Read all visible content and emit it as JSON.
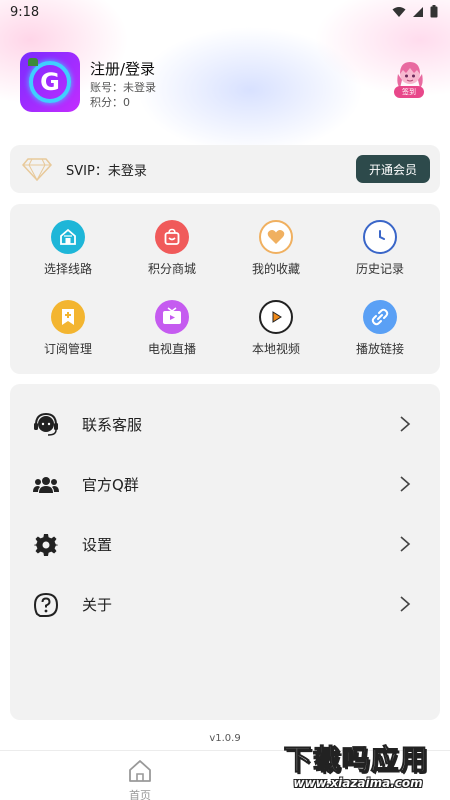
{
  "status_bar": {
    "time": "9:18"
  },
  "profile": {
    "name": "注册/登录",
    "account": "账号：未登录",
    "points": "积分：0",
    "avatar_letter": "G",
    "checkin_label": "签到"
  },
  "vip": {
    "text": "SVIP：未登录",
    "button": "开通会员"
  },
  "grid": {
    "items": [
      {
        "label": "选择线路",
        "icon": "home-route-icon",
        "color": "#1eb6d8"
      },
      {
        "label": "积分商城",
        "icon": "shopping-bag-icon",
        "color": "#f05a5a"
      },
      {
        "label": "我的收藏",
        "icon": "heart-icon",
        "color": "#f0b060"
      },
      {
        "label": "历史记录",
        "icon": "clock-icon",
        "color": "#3a66c8"
      },
      {
        "label": "订阅管理",
        "icon": "bookmark-plus-icon",
        "color": "#f3b530"
      },
      {
        "label": "电视直播",
        "icon": "tv-play-icon",
        "color": "#c55bf0"
      },
      {
        "label": "本地视频",
        "icon": "play-circle-icon",
        "color": "#f08a1a"
      },
      {
        "label": "播放链接",
        "icon": "link-icon",
        "color": "#5aa0f5"
      }
    ]
  },
  "menu": {
    "items": [
      {
        "label": "联系客服",
        "icon": "headset-icon"
      },
      {
        "label": "官方Q群",
        "icon": "group-icon"
      },
      {
        "label": "设置",
        "icon": "gear-icon"
      },
      {
        "label": "关于",
        "icon": "question-icon"
      }
    ]
  },
  "version": "v1.0.9",
  "nav": {
    "home": "首页"
  },
  "watermark": {
    "text": "下载吗应用",
    "url": "www.xiazaima.com"
  }
}
